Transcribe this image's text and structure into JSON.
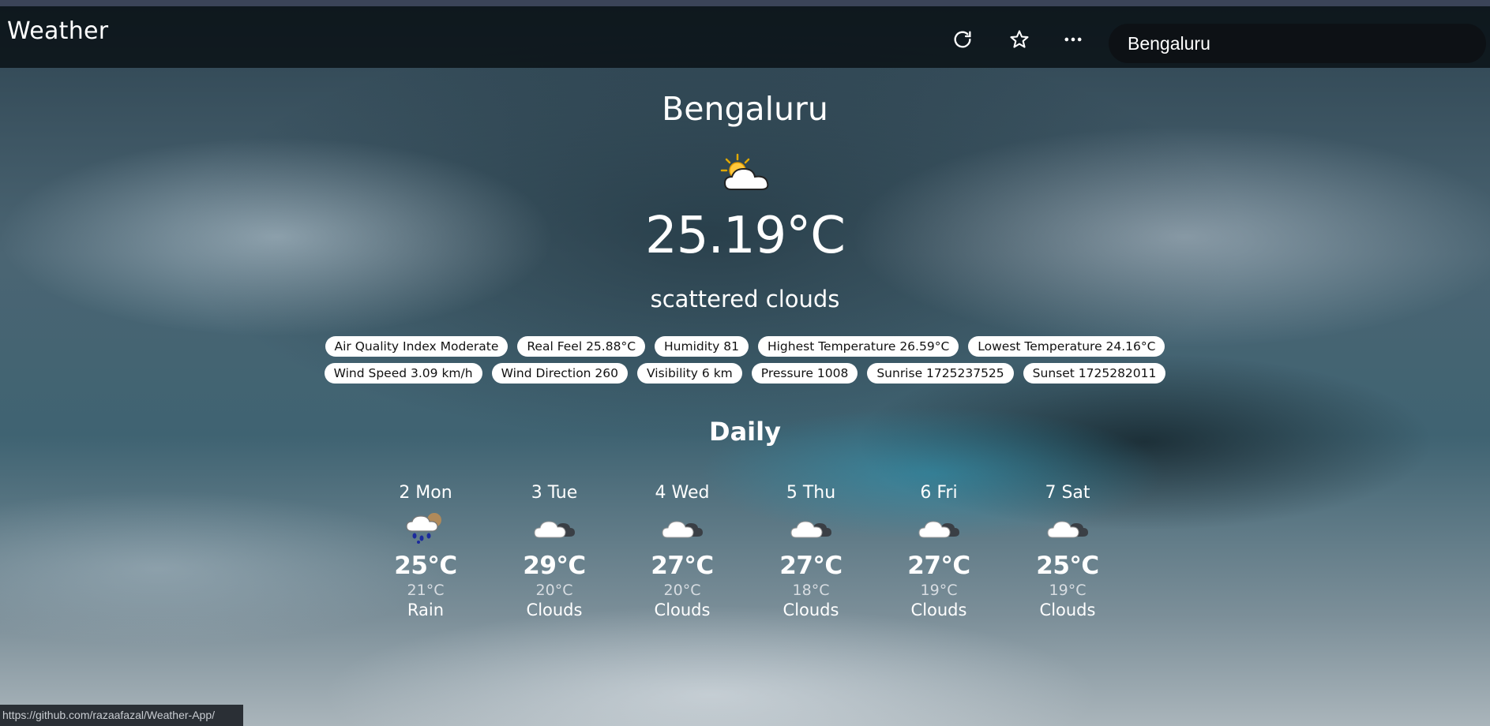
{
  "header": {
    "brand": "Weather",
    "icons": [
      "refresh-icon",
      "star-icon",
      "more-icon"
    ],
    "search": {
      "value": "Bengaluru",
      "placeholder": ""
    }
  },
  "current": {
    "city": "Bengaluru",
    "icon": "sun-behind-cloud-icon",
    "temperature": "25.19°C",
    "description": "scattered clouds",
    "details_row1": [
      "Air Quality Index Moderate",
      "Real Feel 25.88°C",
      "Humidity 81",
      "Highest Temperature 26.59°C",
      "Lowest Temperature 24.16°C"
    ],
    "details_row2": [
      "Wind Speed 3.09 km/h",
      "Wind Direction 260",
      "Visibility 6 km",
      "Pressure 1008",
      "Sunrise 1725237525",
      "Sunset 1725282011"
    ]
  },
  "daily": {
    "title": "Daily",
    "days": [
      {
        "day": "2 Mon",
        "icon": "rain-cloud-icon",
        "max": "25°C",
        "min": "21°C",
        "condition": "Rain"
      },
      {
        "day": "3 Tue",
        "icon": "clouds-icon",
        "max": "29°C",
        "min": "20°C",
        "condition": "Clouds"
      },
      {
        "day": "4 Wed",
        "icon": "clouds-icon",
        "max": "27°C",
        "min": "20°C",
        "condition": "Clouds"
      },
      {
        "day": "5 Thu",
        "icon": "clouds-icon",
        "max": "27°C",
        "min": "18°C",
        "condition": "Clouds"
      },
      {
        "day": "6 Fri",
        "icon": "clouds-icon",
        "max": "27°C",
        "min": "19°C",
        "condition": "Clouds"
      },
      {
        "day": "7 Sat",
        "icon": "clouds-icon",
        "max": "25°C",
        "min": "19°C",
        "condition": "Clouds"
      }
    ]
  },
  "statusbar": {
    "url": "https://github.com/razaafazal/Weather-App/"
  }
}
